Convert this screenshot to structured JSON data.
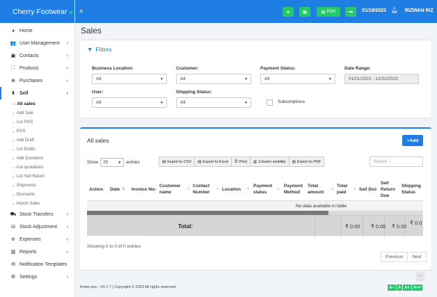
{
  "brand": {
    "name": "Cherry Footwear"
  },
  "topbar": {
    "pos_label": "POS",
    "date": "01/19/2023",
    "user": "RIZWAN RIZ"
  },
  "sidebar": {
    "items": [
      {
        "label": "Home",
        "icon": "dashboard-icon"
      },
      {
        "label": "User Management",
        "icon": "users-icon"
      },
      {
        "label": "Contacts",
        "icon": "address-book-icon"
      },
      {
        "label": "Products",
        "icon": "cubes-icon"
      },
      {
        "label": "Purchases",
        "icon": "plus-circle-icon"
      },
      {
        "label": "Sell",
        "icon": "arrow-circle-up-icon"
      },
      {
        "label": "Stock Transfers",
        "icon": "truck-icon"
      },
      {
        "label": "Stock Adjustment",
        "icon": "database-icon"
      },
      {
        "label": "Expenses",
        "icon": "minus-circle-icon"
      },
      {
        "label": "Reports",
        "icon": "bar-chart-icon"
      },
      {
        "label": "Notification Templates",
        "icon": "envelope-icon"
      },
      {
        "label": "Settings",
        "icon": "cog-icon"
      }
    ],
    "sell_sub": [
      "All sales",
      "Add Sale",
      "List POS",
      "POS",
      "Add Draft",
      "List Drafts",
      "Add Quotation",
      "List quotations",
      "List Sell Return",
      "Shipments",
      "Discounts",
      "Import Sales"
    ]
  },
  "page": {
    "title": "Sales"
  },
  "filters": {
    "title": "Filters",
    "business_location": {
      "label": "Business Location:",
      "value": "All"
    },
    "customer": {
      "label": "Customer:",
      "value": "All"
    },
    "payment_status": {
      "label": "Payment Status:",
      "value": "All"
    },
    "date_range": {
      "label": "Date Range:",
      "value": "01/01/2023 - 12/31/2023"
    },
    "user": {
      "label": "User:",
      "value": "All"
    },
    "shipping_status": {
      "label": "Shipping Status:",
      "value": "All"
    },
    "subscriptions": {
      "label": "Subscriptions",
      "checked": false
    }
  },
  "sales": {
    "title": "All sales",
    "add_label": "Add",
    "show_label": "Show",
    "page_length": "25",
    "entries_label": "entries",
    "exports": [
      "Export to CSV",
      "Export to Excel",
      "Print",
      "Column visibility",
      "Export to PDF"
    ],
    "search_placeholder": "Search ...",
    "columns": [
      "Action",
      "Date",
      "Invoice No.",
      "Customer name",
      "Contact Number",
      "Location",
      "Payment status",
      "Payment Method",
      "Total amount",
      "Total paid",
      "Sell Due",
      "Sell Return Due",
      "Shipping Status"
    ],
    "empty_text": "No data available in table",
    "total_label": "Total:",
    "totals": [
      "₹ 0.00",
      "₹ 0.00",
      "₹ 0.00",
      "₹ 0.0"
    ],
    "info": "Showing 0 to 0 of 0 entries",
    "prev": "Previous",
    "next": "Next"
  },
  "footer": {
    "text": "footie pos - V4.7.7 | Copyright © 2023 All rights reserved."
  },
  "font_controls": [
    "A−",
    "A",
    "A+",
    "A++"
  ],
  "colors": {
    "primary": "#1e7ee4",
    "success": "#27c86a"
  }
}
